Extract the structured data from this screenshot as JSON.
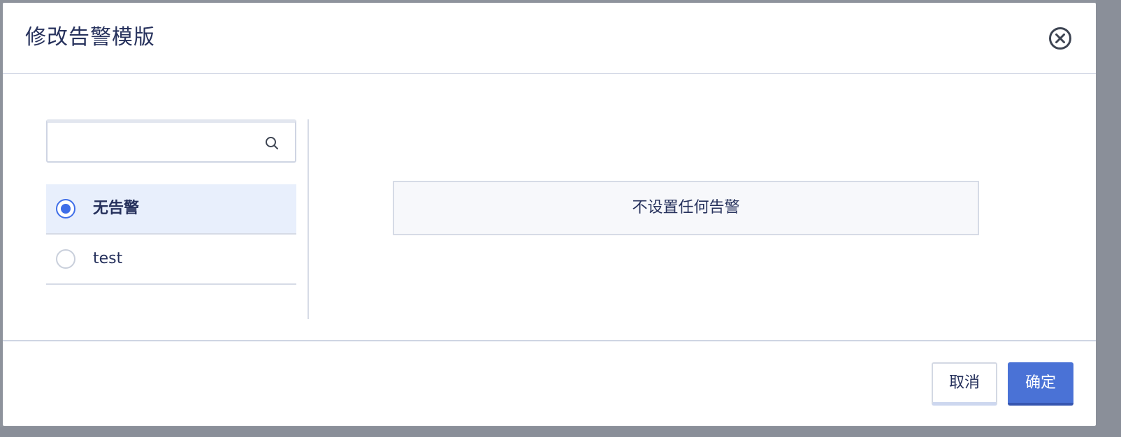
{
  "dialog": {
    "title": "修改告警模版",
    "close_icon": "close-circle-icon"
  },
  "search": {
    "value": "",
    "placeholder": "",
    "icon": "search-icon"
  },
  "options": [
    {
      "label": "无告警",
      "selected": true
    },
    {
      "label": "test",
      "selected": false
    }
  ],
  "preview": {
    "text": "不设置任何告警"
  },
  "footer": {
    "cancel_label": "取消",
    "confirm_label": "确定"
  },
  "colors": {
    "title_text": "#26315c",
    "accent": "#3f6ee8",
    "primary_button": "#4a72d6",
    "selected_row": "#e8effc"
  }
}
